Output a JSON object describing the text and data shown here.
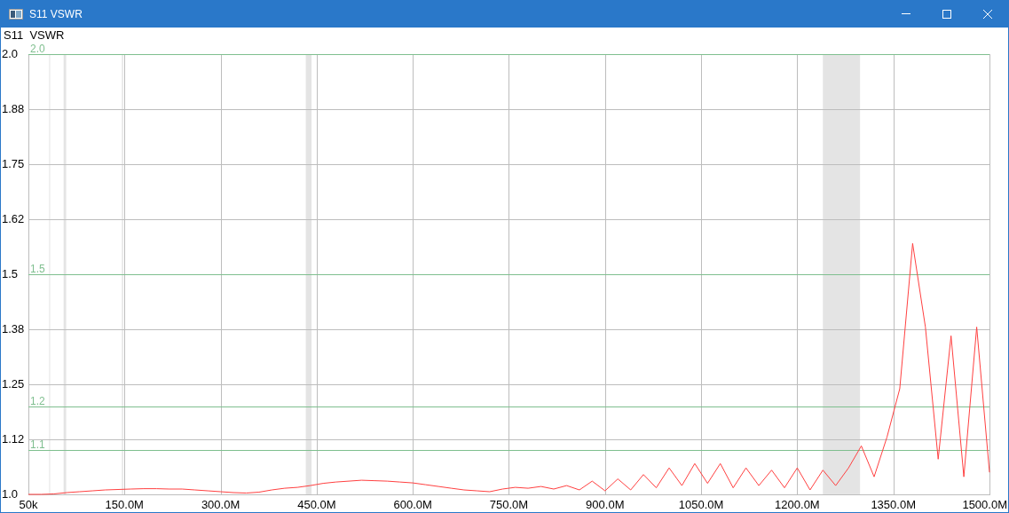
{
  "window": {
    "title": "S11 VSWR"
  },
  "chart": {
    "chart_data": {
      "type": "line",
      "title": "S11  VSWR",
      "xlim": [
        50000,
        1500000000
      ],
      "ylim": [
        1.0,
        2.0
      ],
      "xticks": [
        {
          "value": 50000,
          "label": "50k"
        },
        {
          "value": 150000000,
          "label": "150.0M"
        },
        {
          "value": 300000000,
          "label": "300.0M"
        },
        {
          "value": 450000000,
          "label": "450.0M"
        },
        {
          "value": 600000000,
          "label": "600.0M"
        },
        {
          "value": 750000000,
          "label": "750.0M"
        },
        {
          "value": 900000000,
          "label": "900.0M"
        },
        {
          "value": 1050000000,
          "label": "1050.0M"
        },
        {
          "value": 1200000000,
          "label": "1200.0M"
        },
        {
          "value": 1350000000,
          "label": "1350.0M"
        },
        {
          "value": 1500000000,
          "label": "1500.0M"
        }
      ],
      "yticks": [
        {
          "value": 1.0,
          "label": "1.0"
        },
        {
          "value": 1.125,
          "label": "1.12"
        },
        {
          "value": 1.25,
          "label": "1.25"
        },
        {
          "value": 1.375,
          "label": "1.38"
        },
        {
          "value": 1.5,
          "label": "1.5"
        },
        {
          "value": 1.625,
          "label": "1.62"
        },
        {
          "value": 1.75,
          "label": "1.75"
        },
        {
          "value": 1.875,
          "label": "1.88"
        },
        {
          "value": 2.0,
          "label": "2.0"
        }
      ],
      "x": [
        50000,
        20000000,
        40000000,
        60000000,
        80000000,
        100000000,
        120000000,
        140000000,
        160000000,
        180000000,
        200000000,
        220000000,
        240000000,
        260000000,
        280000000,
        300000000,
        320000000,
        340000000,
        360000000,
        380000000,
        400000000,
        420000000,
        440000000,
        460000000,
        480000000,
        500000000,
        520000000,
        540000000,
        560000000,
        580000000,
        600000000,
        620000000,
        640000000,
        660000000,
        680000000,
        700000000,
        720000000,
        740000000,
        760000000,
        780000000,
        800000000,
        820000000,
        840000000,
        860000000,
        880000000,
        900000000,
        920000000,
        940000000,
        960000000,
        980000000,
        1000000000,
        1020000000,
        1040000000,
        1060000000,
        1080000000,
        1100000000,
        1120000000,
        1140000000,
        1160000000,
        1180000000,
        1200000000,
        1220000000,
        1240000000,
        1260000000,
        1280000000,
        1300000000,
        1320000000,
        1340000000,
        1360000000,
        1380000000,
        1400000000,
        1420000000,
        1440000000,
        1460000000,
        1480000000,
        1500000000
      ],
      "series": [
        {
          "color": "#ff4040",
          "values": [
            1.0,
            1.0,
            1.001,
            1.004,
            1.006,
            1.008,
            1.01,
            1.011,
            1.012,
            1.013,
            1.013,
            1.012,
            1.012,
            1.01,
            1.008,
            1.006,
            1.004,
            1.003,
            1.005,
            1.01,
            1.014,
            1.016,
            1.02,
            1.025,
            1.028,
            1.03,
            1.032,
            1.031,
            1.03,
            1.028,
            1.026,
            1.022,
            1.018,
            1.014,
            1.01,
            1.008,
            1.006,
            1.012,
            1.016,
            1.014,
            1.018,
            1.012,
            1.02,
            1.01,
            1.03,
            1.008,
            1.035,
            1.01,
            1.045,
            1.015,
            1.06,
            1.02,
            1.07,
            1.025,
            1.07,
            1.015,
            1.06,
            1.02,
            1.055,
            1.015,
            1.06,
            1.01,
            1.055,
            1.02,
            1.06,
            1.11,
            1.04,
            1.13,
            1.24,
            1.57,
            1.38,
            1.08,
            1.36,
            1.04,
            1.38,
            1.05
          ]
        }
      ],
      "grid": true,
      "bands": [
        {
          "axis": "x",
          "from": 32500000,
          "to": 33500000
        },
        {
          "axis": "x",
          "from": 55000000,
          "to": 59000000
        },
        {
          "axis": "x",
          "from": 146000000,
          "to": 148000000
        },
        {
          "axis": "x",
          "from": 433000000,
          "to": 442000000
        },
        {
          "axis": "x",
          "from": 1240000000,
          "to": 1298000000
        }
      ],
      "ref_lines": [
        {
          "axis": "y",
          "value": 2.0,
          "label": "2.0",
          "color": "#7fbf8f"
        },
        {
          "axis": "y",
          "value": 1.5,
          "label": "1.5",
          "color": "#7fbf8f"
        },
        {
          "axis": "y",
          "value": 1.2,
          "label": "1.2",
          "color": "#7fbf8f"
        },
        {
          "axis": "y",
          "value": 1.1,
          "label": "1.1",
          "color": "#7fbf8f"
        }
      ]
    }
  }
}
